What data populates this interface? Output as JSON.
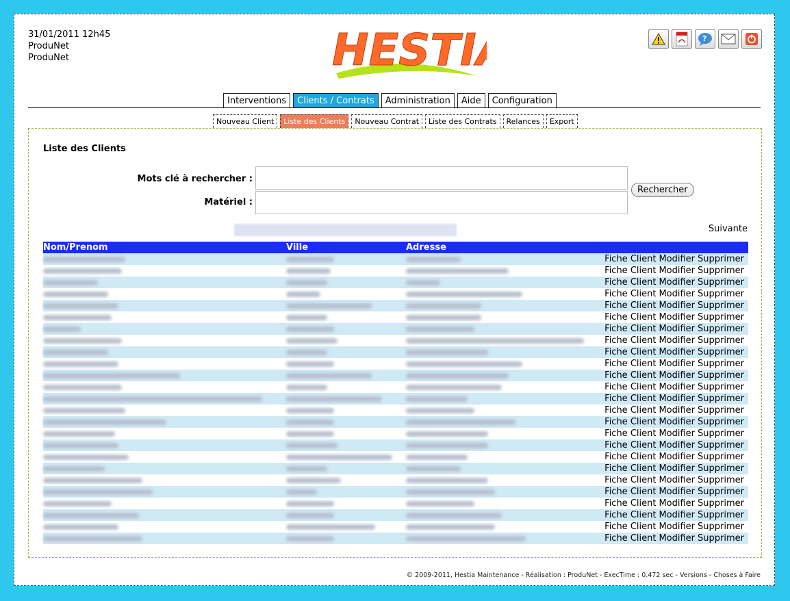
{
  "header": {
    "datetime": "31/01/2011 12h45",
    "line2": "ProduNet",
    "line3": "ProduNet",
    "logo_text": "HESTIA"
  },
  "toolbar": [
    {
      "name": "warning-icon",
      "label": "Alerte"
    },
    {
      "name": "pdf-icon",
      "label": "PDF"
    },
    {
      "name": "help-icon",
      "label": "Aide"
    },
    {
      "name": "mail-icon",
      "label": "Email"
    },
    {
      "name": "power-icon",
      "label": "Déconnexion"
    }
  ],
  "tabs": [
    {
      "label": "Interventions",
      "active": false
    },
    {
      "label": "Clients / Contrats",
      "active": true
    },
    {
      "label": "Administration",
      "active": false
    },
    {
      "label": "Aide",
      "active": false
    },
    {
      "label": "Configuration",
      "active": false
    }
  ],
  "subtabs": [
    {
      "label": "Nouveau Client",
      "active": false
    },
    {
      "label": "Liste des Clients",
      "active": true
    },
    {
      "label": "Nouveau Contrat",
      "active": false
    },
    {
      "label": "Liste des Contrats",
      "active": false
    },
    {
      "label": "Relances",
      "active": false
    },
    {
      "label": "Export",
      "active": false
    }
  ],
  "content": {
    "title": "Liste des Clients",
    "keywords_label": "Mots clé à rechercher :",
    "keywords_value": "",
    "material_label": "Matériel :",
    "material_value": "",
    "search_button": "Rechercher",
    "next_label": "Suivante"
  },
  "table": {
    "headers": [
      "Nom/Prenom",
      "Ville",
      "Adresse"
    ],
    "action_labels": [
      "Fiche Client",
      "Modifier",
      "Supprimer"
    ],
    "row_count": 25
  },
  "colors": {
    "background": "#2ec8ee",
    "active_tab": "#1fa8e0",
    "active_subtab": "#f07c5a",
    "table_header": "#1a2cf7",
    "row_alt": "#cfe9f5"
  },
  "footer": {
    "text": "© 2009-2011, Hestia Maintenance - Réalisation : ProduNet - ExecTime : 0.472 sec - Versions - Choses à Faire"
  }
}
